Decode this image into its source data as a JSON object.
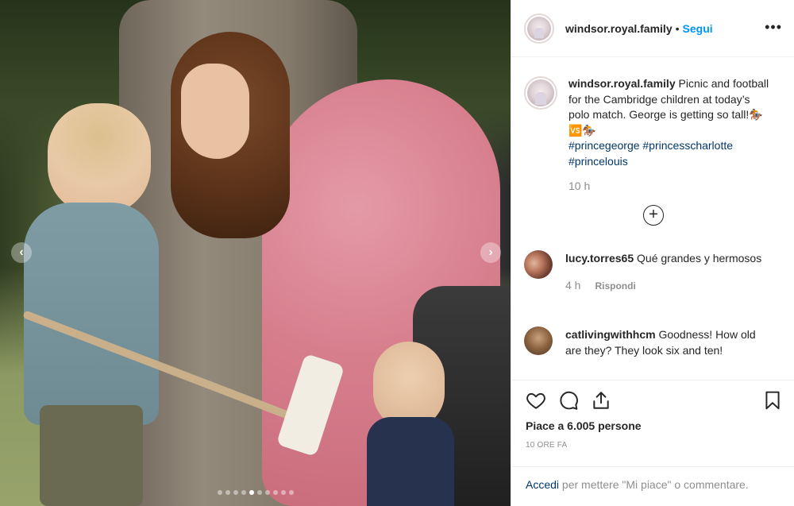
{
  "post": {
    "photo": {
      "description_icon": "photo",
      "carousel_index": 4,
      "carousel_count": 10
    },
    "header": {
      "username": "windsor.royal.family",
      "separator": "•",
      "follow_label": "Segui",
      "more_icon": "more-horizontal-icon",
      "more_glyph": "•••"
    },
    "caption": {
      "username": "windsor.royal.family",
      "text": "Picnic and football for the Cambridge children at today’s polo match. George is getting so tall!🏇🆚🏇",
      "hashtags": "#princegeorge #princesscharlotte #princelouis",
      "time": "10 h"
    },
    "load_more_glyph": "+",
    "comments": [
      {
        "username": "lucy.torres65",
        "text": "Qué grandes y hermosos",
        "time": "4 h",
        "reply_label": "Rispondi"
      },
      {
        "username": "catlivingwithhcm",
        "text": "Goodness! How old are they? They look six and ten!"
      }
    ],
    "actions": {
      "like_icon": "heart-icon",
      "comment_icon": "comment-icon",
      "share_icon": "share-icon",
      "save_icon": "bookmark-icon"
    },
    "likes_text": "Piace a 6.005 persone",
    "time_ago": "10 ORE FA",
    "login_prompt": {
      "login_label": "Accedi",
      "rest": " per mettere \"Mi piace\" o commentare."
    }
  }
}
